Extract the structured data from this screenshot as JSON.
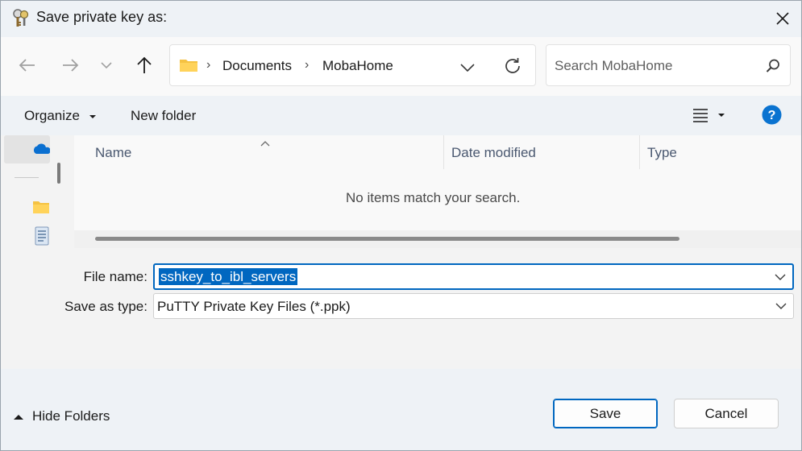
{
  "window": {
    "title": "Save private key as:"
  },
  "nav": {
    "breadcrumb": [
      "Documents",
      "MobaHome"
    ],
    "search_placeholder": "Search MobaHome"
  },
  "commands": {
    "organize_label": "Organize",
    "new_folder_label": "New folder"
  },
  "file_list": {
    "columns": [
      "Name",
      "Date modified",
      "Type"
    ],
    "empty_message": "No items match your search."
  },
  "form": {
    "file_name_label": "File name:",
    "file_name_value": "sshkey_to_ibl_servers",
    "save_type_label": "Save as type:",
    "save_type_value": "PuTTY Private Key Files (*.ppk)"
  },
  "footer": {
    "hide_folders_label": "Hide Folders",
    "save_label": "Save",
    "cancel_label": "Cancel"
  },
  "colors": {
    "accent": "#0067c0",
    "folder": "#f5c242"
  }
}
